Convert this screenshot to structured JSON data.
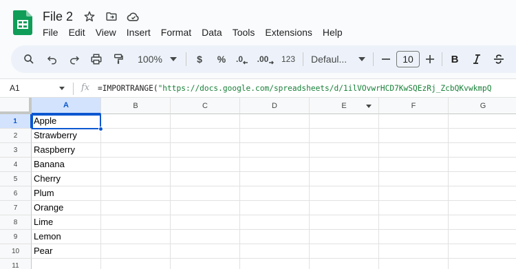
{
  "app": {
    "doc_title": "File 2",
    "brand_color": "#0F9D58",
    "accent_color": "#0B57D0"
  },
  "menu": [
    "File",
    "Edit",
    "View",
    "Insert",
    "Format",
    "Data",
    "Tools",
    "Extensions",
    "Help"
  ],
  "toolbar": {
    "zoom": "100%",
    "currency": "$",
    "percent": "%",
    "decrease_decimal": ".0",
    "increase_decimal": ".00",
    "number_format": "123",
    "font_name": "Defaul...",
    "font_size": "10",
    "bold": "B"
  },
  "formula_bar": {
    "cell_ref": "A1",
    "fx": "fx",
    "formula_prefix": "=IMPORTRANGE(",
    "formula_string": "\"https://docs.google.com/spreadsheets/d/1ilVOvwrHCD7KwSQEzRj_ZcbQKvwkmpQ"
  },
  "sheet": {
    "columns": [
      "A",
      "B",
      "C",
      "D",
      "E",
      "F",
      "G"
    ],
    "rows": [
      "1",
      "2",
      "3",
      "4",
      "5",
      "6",
      "7",
      "8",
      "9",
      "10",
      "11"
    ],
    "column_a_values": [
      "Apple",
      "Strawberry",
      "Raspberry",
      "Banana",
      "Cherry",
      "Plum",
      "Orange",
      "Lime",
      "Lemon",
      "Pear",
      ""
    ],
    "selected_cell": "A1"
  }
}
